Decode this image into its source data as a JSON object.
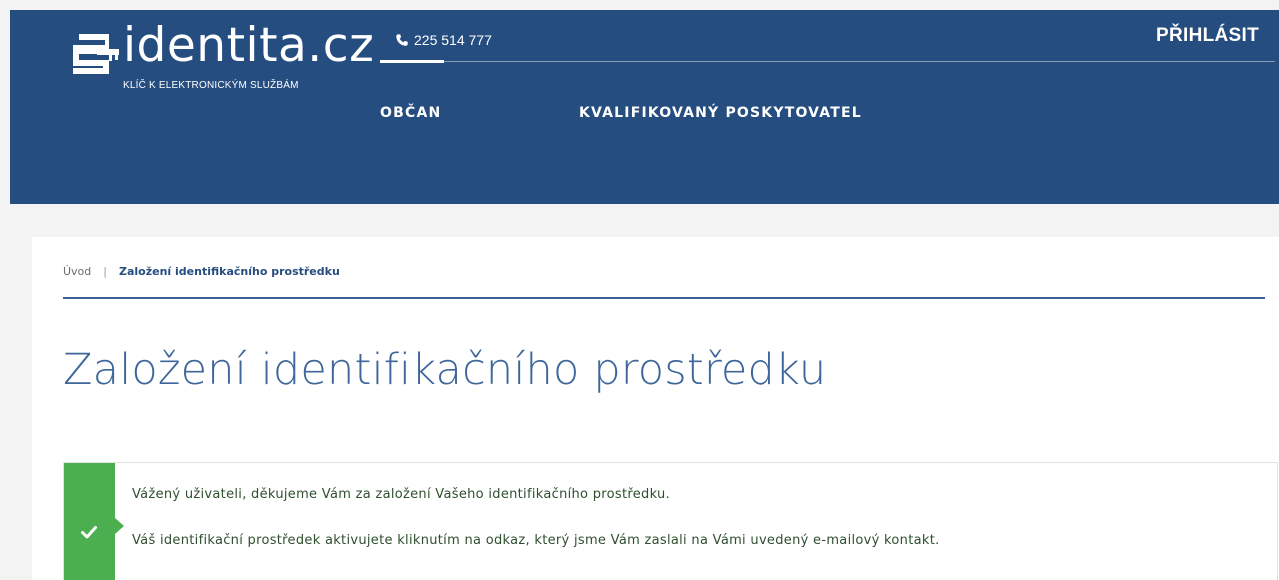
{
  "header": {
    "logo": {
      "word": "identita.cz",
      "tagline": "KLÍČ K ELEKTRONICKÝM SLUŽBÁM"
    },
    "phone": "225 514 777",
    "login_label": "PŘIHLÁSIT",
    "nav": [
      {
        "label": "OBČAN"
      },
      {
        "label": "KVALIFIKOVANÝ POSKYTOVATEL"
      }
    ]
  },
  "breadcrumb": {
    "home": "Úvod",
    "separator": "|",
    "current": "Založení identifikačního prostředku"
  },
  "page": {
    "title": "Založení identifikačního prostředku"
  },
  "alert": {
    "type": "success",
    "messages": [
      "Vážený uživateli, děkujeme Vám za založení Vašeho identifikačního prostředku.",
      "Váš identifikační prostředek aktivujete kliknutím na odkaz, který jsme Vám zaslali na Vámi uvedený e-mailový kontakt."
    ]
  },
  "colors": {
    "header_bg": "#264d80",
    "title": "#3e669a",
    "success": "#4caf4f"
  },
  "icons": {
    "logo": "e-key-logo-icon",
    "phone": "phone-icon",
    "alert": "check-icon"
  }
}
